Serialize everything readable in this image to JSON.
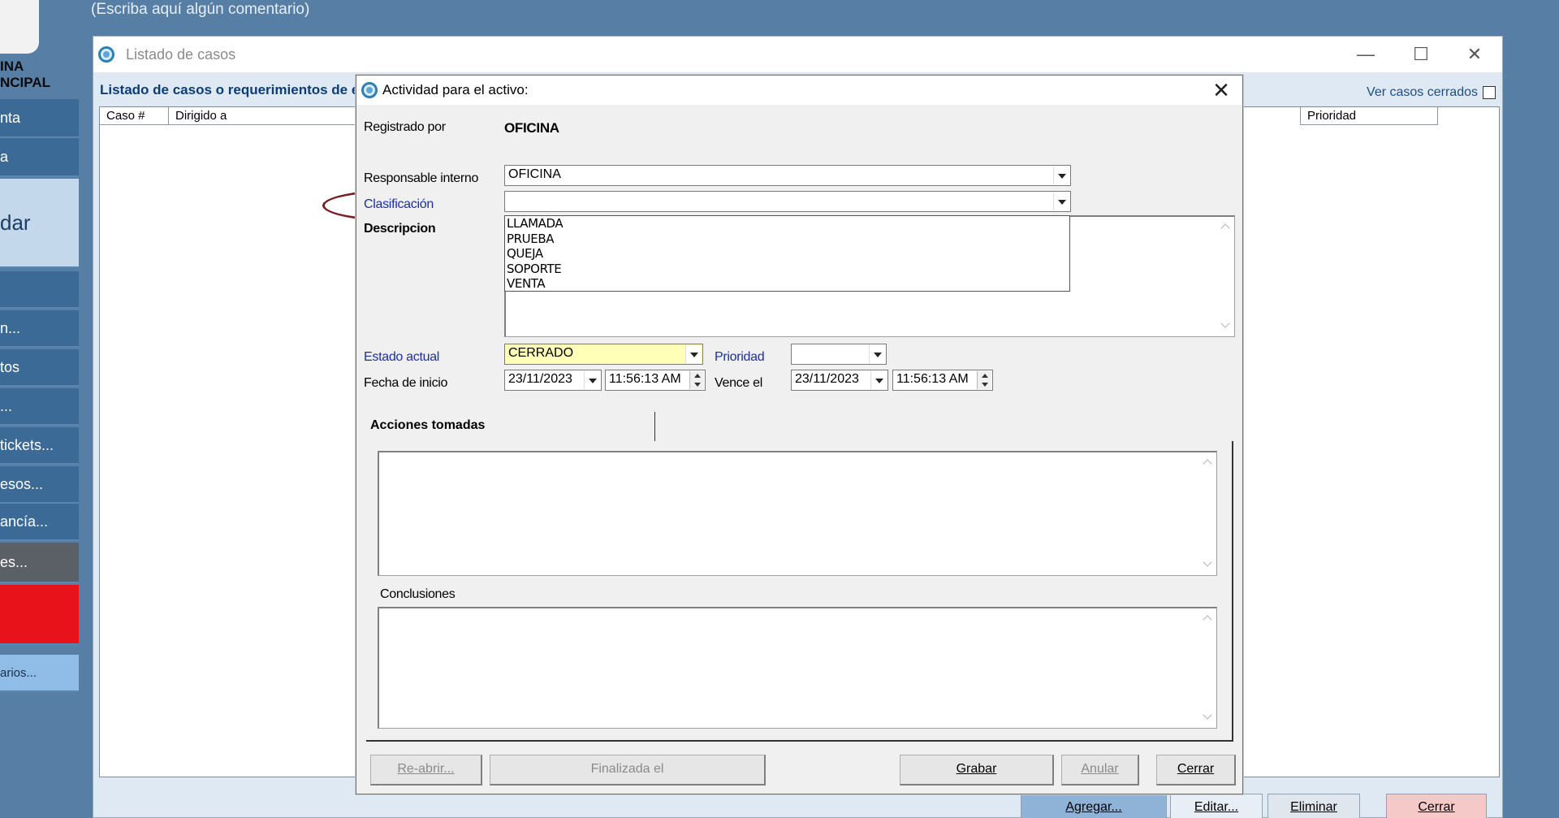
{
  "comment_bar": {
    "placeholder_text": "(Escriba aquí algún comentario)"
  },
  "sidebar": {
    "logo_line1": "INA",
    "logo_line2": "NCIPAL",
    "items": [
      {
        "label": "nta"
      },
      {
        "label": "a"
      },
      {
        "label": "dar"
      },
      {
        "label": ""
      },
      {
        "label": "n..."
      },
      {
        "label": "tos"
      },
      {
        "label": "..."
      },
      {
        "label": "tickets..."
      },
      {
        "label": "esos..."
      },
      {
        "label": "ancía..."
      },
      {
        "label": "es..."
      },
      {
        "label": ""
      },
      {
        "label": "arios..."
      }
    ]
  },
  "list_window": {
    "title": "Listado de casos",
    "heading": "Listado de casos o requerimientos de e",
    "ver_casos_cerrados": "Ver casos cerrados",
    "columns": [
      "Caso #",
      "Dirigido a",
      "Prioridad"
    ],
    "buttons": {
      "agregar": "Agregar...",
      "editar": "Editar...",
      "eliminar": "Eliminar",
      "cerrar": "Cerrar"
    }
  },
  "dialog": {
    "title": "Actividad para el activo:",
    "registrado_por_label": "Registrado por",
    "registrado_por_value": "OFICINA",
    "responsable_label": "Responsable interno",
    "responsable_value": "OFICINA",
    "clasificacion_label": "Clasificación",
    "clasificacion_value": "",
    "clasificacion_options": [
      "LLAMADA",
      "PRUEBA",
      "QUEJA",
      "SOPORTE",
      "VENTA"
    ],
    "descripcion_label": "Descripcion",
    "estado_label": "Estado actual",
    "estado_value": "CERRADO",
    "prioridad_label": "Prioridad",
    "prioridad_value": "",
    "fecha_inicio_label": "Fecha de inicio",
    "fecha_inicio_date": "23/11/2023",
    "fecha_inicio_time": "11:56:13 AM",
    "vence_label": "Vence el",
    "vence_date": "23/11/2023",
    "vence_time": "11:56:13 AM",
    "tab_acciones": "Acciones tomadas",
    "conclusiones_label": "Conclusiones",
    "buttons": {
      "reabrir": "Re-abrir...",
      "finalizada": "Finalizada el",
      "grabar": "Grabar",
      "anular": "Anular",
      "cerrar": "Cerrar"
    }
  },
  "colors": {
    "accent_annotation": "#7a1a22",
    "estado_bg": "#ffffb8",
    "label_blue": "#1e2ea0"
  }
}
